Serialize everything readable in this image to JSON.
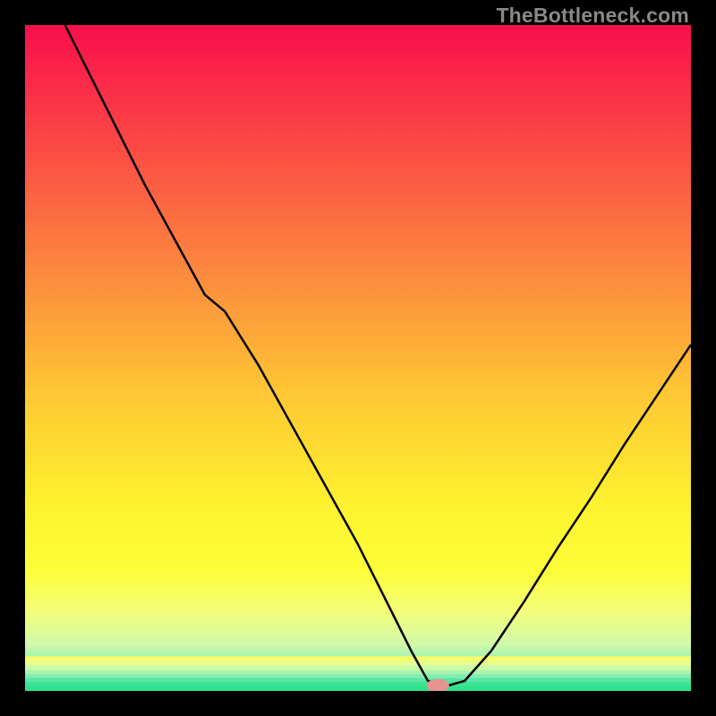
{
  "watermark": "TheBottleneck.com",
  "chart_data": {
    "type": "line",
    "title": "",
    "xlabel": "",
    "ylabel": "",
    "xlim": [
      0,
      100
    ],
    "ylim": [
      0,
      100
    ],
    "grid": false,
    "background": {
      "type": "vertical-gradient",
      "stops": [
        {
          "pos": 0.0,
          "color": "#f90e4c"
        },
        {
          "pos": 0.2,
          "color": "#fb5044"
        },
        {
          "pos": 0.4,
          "color": "#fc933d"
        },
        {
          "pos": 0.55,
          "color": "#fec634"
        },
        {
          "pos": 0.72,
          "color": "#fef22f"
        },
        {
          "pos": 0.82,
          "color": "#fdfe39"
        },
        {
          "pos": 0.88,
          "color": "#f4fe79"
        },
        {
          "pos": 0.93,
          "color": "#d1faaa"
        },
        {
          "pos": 0.965,
          "color": "#7feeb4"
        },
        {
          "pos": 1.0,
          "color": "#2ce28d"
        }
      ]
    },
    "background_stripes": [
      {
        "y": 95.5,
        "color": "#f7fe6a"
      },
      {
        "y": 96.2,
        "color": "#e6fd91"
      },
      {
        "y": 96.9,
        "color": "#cdfaa6"
      },
      {
        "y": 97.5,
        "color": "#aaf4af"
      },
      {
        "y": 98.1,
        "color": "#82edb3"
      },
      {
        "y": 98.7,
        "color": "#57e7a2"
      },
      {
        "y": 99.3,
        "color": "#3be494"
      },
      {
        "y": 100.0,
        "color": "#2ce28d"
      }
    ],
    "marker": {
      "x": 62,
      "y": 99.2,
      "color": "#e6948f",
      "rx": 1.7,
      "ry": 1.0
    },
    "series": [
      {
        "name": "bottleneck-curve",
        "color": "#000000",
        "x": [
          6.0,
          12.0,
          18.0,
          24.0,
          27.0,
          30.0,
          35.0,
          40.0,
          45.0,
          50.0,
          55.0,
          58.0,
          60.5,
          63.5,
          66.0,
          70.0,
          75.0,
          80.0,
          85.0,
          90.0,
          95.0,
          100.0
        ],
        "y": [
          0.0,
          12.0,
          24.0,
          35.0,
          40.5,
          43.0,
          51.0,
          60.0,
          69.0,
          78.0,
          88.0,
          94.0,
          98.5,
          99.2,
          98.5,
          94.0,
          86.5,
          78.5,
          71.0,
          63.0,
          55.5,
          48.0
        ]
      }
    ]
  }
}
